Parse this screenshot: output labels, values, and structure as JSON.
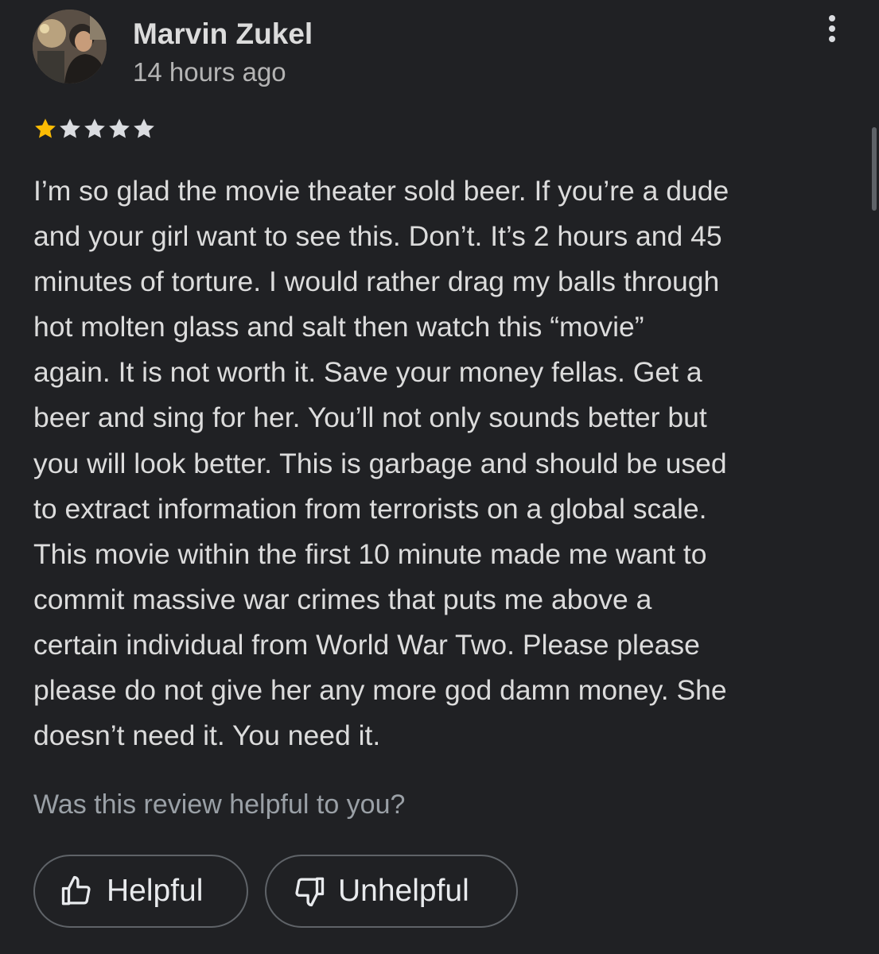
{
  "review": {
    "reviewer_name": "Marvin Zukel",
    "time_ago": "14 hours ago",
    "rating": 1,
    "rating_max": 5,
    "text": "I’m so glad the movie theater sold beer. If you’re a dude\nand your girl want to see this. Don’t. It’s 2 hours and 45\nminutes of torture. I would rather drag my balls through\nhot molten glass and salt then watch this “movie”\nagain. It is not worth it. Save your money fellas. Get a\nbeer and sing for her. You’ll not only sounds better but\nyou will look better. This is garbage and should be used\nto extract information from terrorists on a global scale.\nThis movie within the first 10 minute made me want to\ncommit massive war crimes that puts me above a\ncertain individual from World War Two. Please please\nplease do not give her any more god damn money. She\ndoesn’t need it. You need it."
  },
  "icons": {
    "avatar": "avatar",
    "more": "more-vert-icon",
    "star": "star-icon",
    "helpful": "thumbs-up-icon",
    "unhelpful": "thumbs-down-icon"
  },
  "feedback": {
    "question": "Was this review helpful to you?",
    "helpful_label": "Helpful",
    "unhelpful_label": "Unhelpful"
  },
  "colors": {
    "background": "#202124",
    "star_filled": "#fbbc04",
    "star_empty": "#dadce0",
    "button_border": "#5f6368"
  }
}
